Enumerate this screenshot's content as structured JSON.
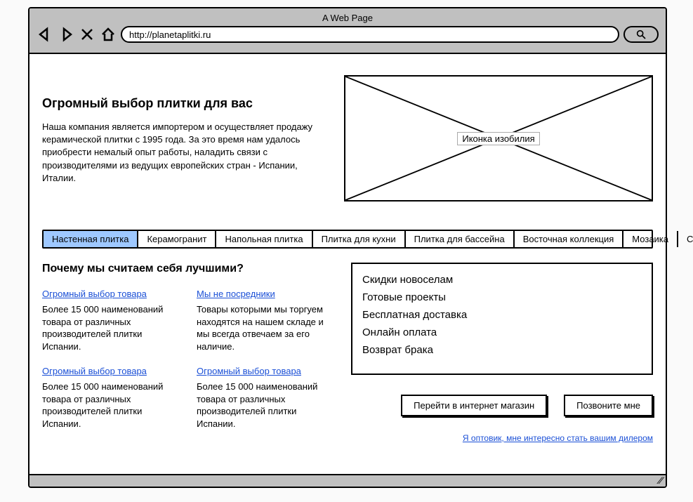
{
  "browser": {
    "title": "A Web Page",
    "url": "http://planetaplitki.ru"
  },
  "hero": {
    "heading": "Огромный выбор плитки для вас",
    "body": "Наша компания является импортером и осуществляет продажу керамической плитки с 1995 года. За это время нам удалось приобрести немалый опыт работы, наладить связи с производителями из ведущих европейских стран - Испании, Италии.",
    "image_label": "Иконка изобилия"
  },
  "tabs": [
    "Настенная плитка",
    "Керамогранит",
    "Напольная плитка",
    "Плитка для кухни",
    "Плитка для бассейна",
    "Восточная коллекция",
    "Мозаика",
    "Ступени"
  ],
  "why": {
    "heading": "Почему мы считаем себя лучшими?",
    "items": [
      {
        "title": "Огромный выбор товара",
        "body": "Более 15 000 наименований товара от различных производителей плитки Испании."
      },
      {
        "title": "Мы не посредники",
        "body": "Товары которыми мы торгуем находятся на нашем складе и мы всегда отвечаем за его наличие."
      },
      {
        "title": "Огромный выбор товара",
        "body": "Более 15 000 наименований товара от различных производителей плитки Испании."
      },
      {
        "title": "Огромный выбор товара",
        "body": "Более 15 000 наименований товара от различных производителей плитки Испании."
      }
    ]
  },
  "benefits": [
    "Скидки новоселам",
    "Готовые проекты",
    "Бесплатная доставка",
    "Онлайн оплата",
    "Возврат брака"
  ],
  "cta": {
    "shop": "Перейти в интернет магазин",
    "call": "Позвоните мне",
    "dealer": "Я оптовик, мне интересно стать вашим дилером "
  }
}
